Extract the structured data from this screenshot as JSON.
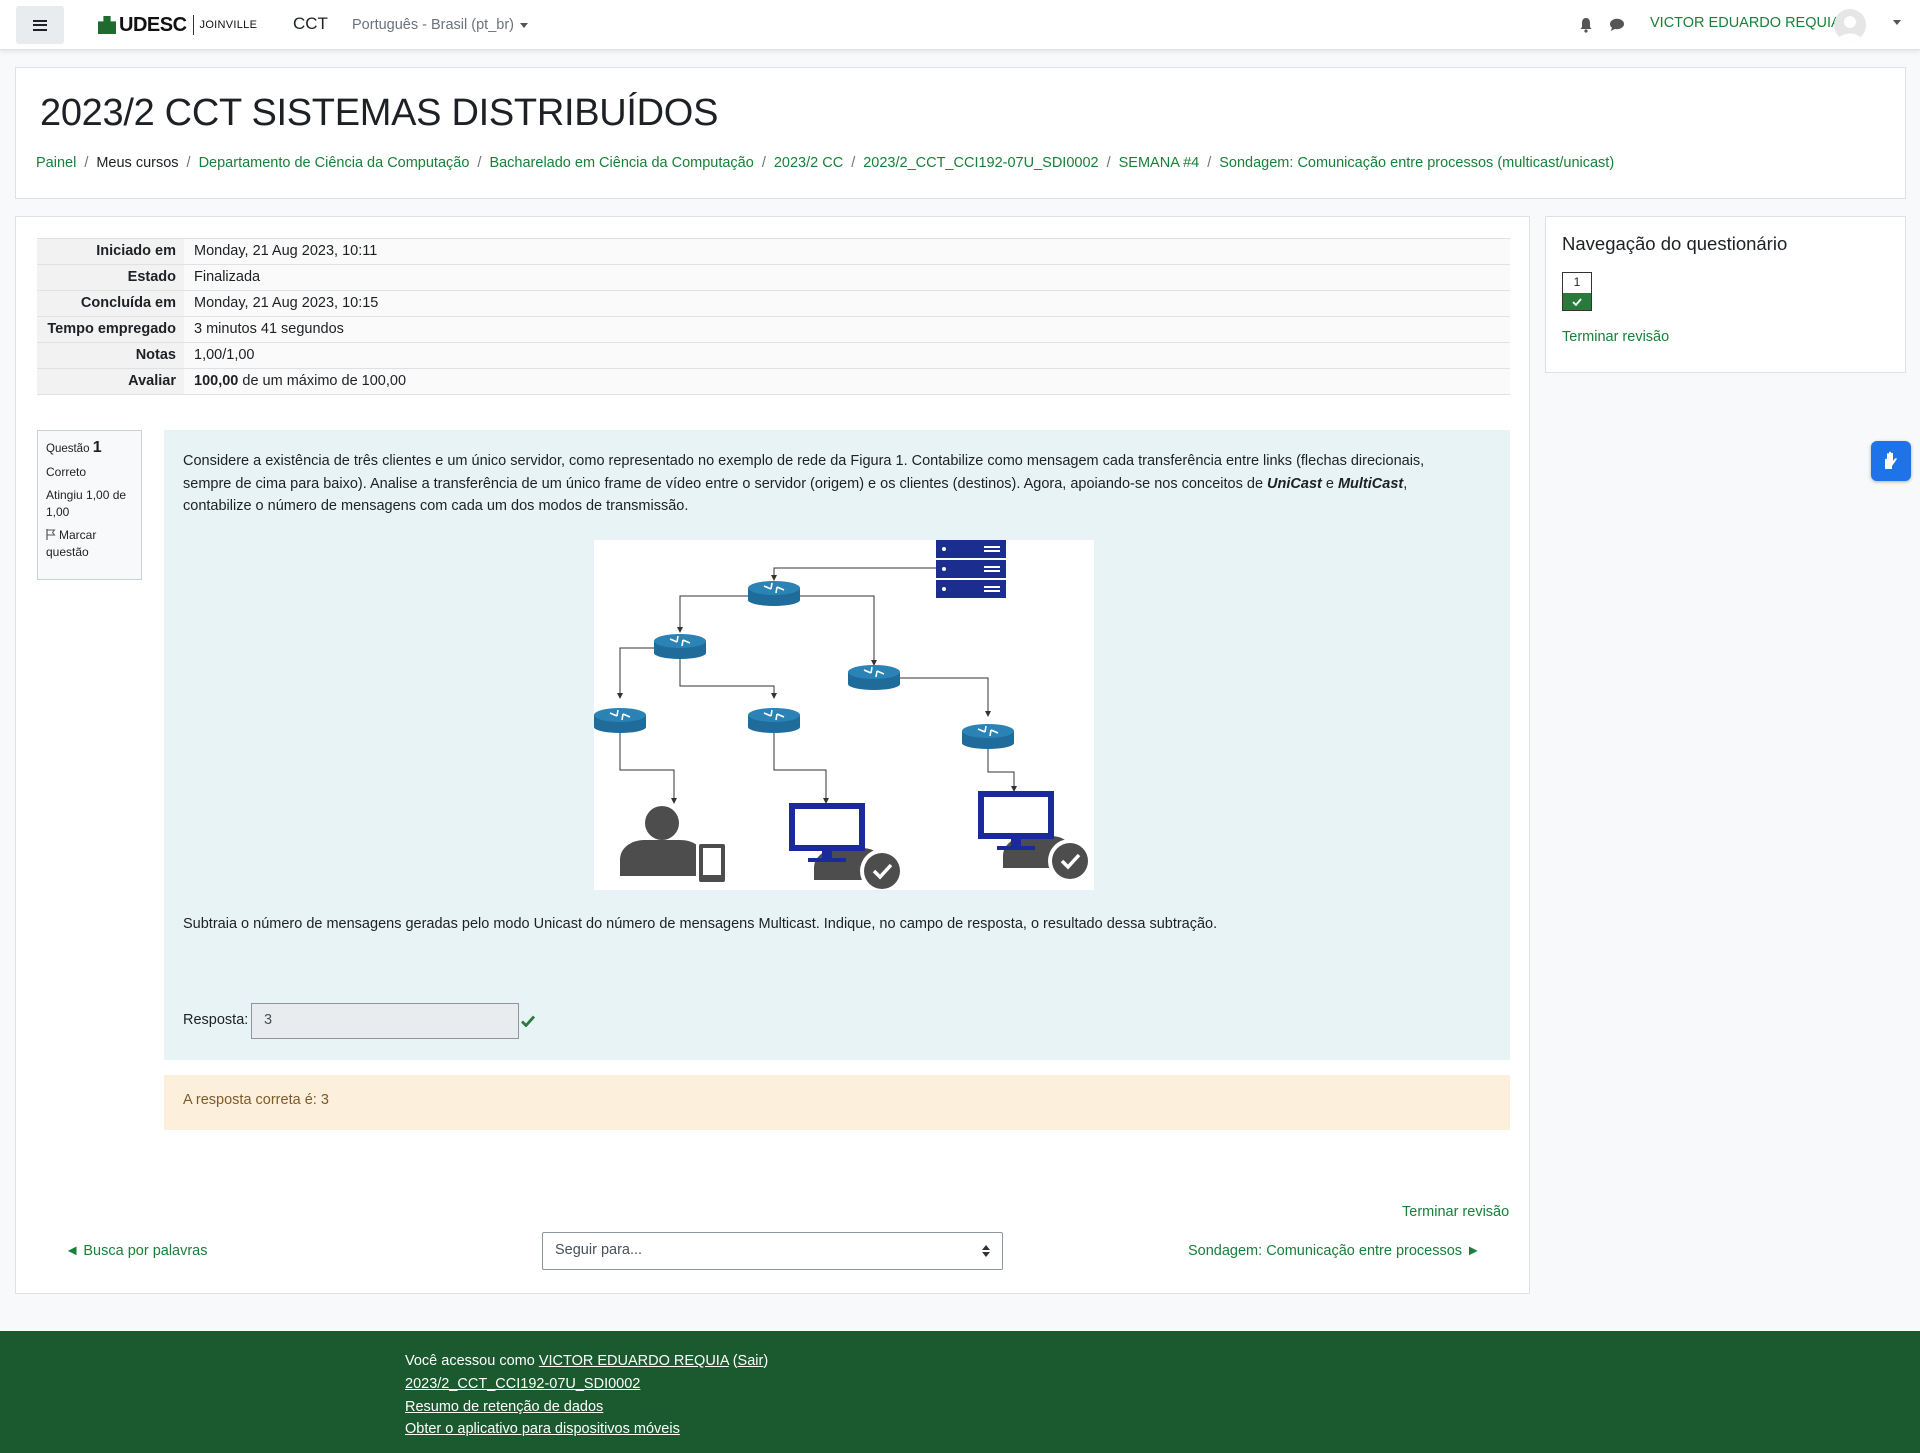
{
  "navbar": {
    "brand_main": "UDESC",
    "brand_sub": "JOINVILLE",
    "site": "CCT",
    "language": "Português - Brasil (pt_br)",
    "user_name": "VICTOR EDUARDO REQUIA"
  },
  "header": {
    "title": "2023/2 CCT SISTEMAS DISTRIBUÍDOS",
    "breadcrumb": [
      "Painel",
      "Meus cursos",
      "Departamento de Ciência da Computação",
      "Bacharelado em Ciência da Computação",
      "2023/2 CC",
      "2023/2_CCT_CCI192-07U_SDI0002",
      "SEMANA #4",
      "Sondagem: Comunicação entre processos (multicast/unicast)"
    ]
  },
  "summary": {
    "rows": [
      {
        "label": "Iniciado em",
        "value": "Monday, 21 Aug 2023, 10:11"
      },
      {
        "label": "Estado",
        "value": "Finalizada"
      },
      {
        "label": "Concluída em",
        "value": "Monday, 21 Aug 2023, 10:15"
      },
      {
        "label": "Tempo empregado",
        "value": "3 minutos 41 segundos"
      },
      {
        "label": "Notas",
        "value": "1,00/1,00"
      },
      {
        "label": "Avaliar",
        "value_bold": "100,00",
        "value": " de um máximo de 100,00"
      }
    ]
  },
  "question": {
    "info": {
      "label": "Questão",
      "number": "1",
      "state": "Correto",
      "grade": "Atingiu 1,00 de 1,00",
      "flag": "Marcar questão"
    },
    "text_part1": "Considere a existência de três clientes e um único servidor, como representado no exemplo de rede da Figura 1. Contabilize como mensagem cada transferência entre links (flechas direcionais, sempre de cima para baixo). Analise a transferência de um único frame de vídeo entre o servidor (origem) e os clientes (destinos). Agora, apoiando-se nos conceitos de ",
    "term_unicast": "UniCast",
    "text_and": " e ",
    "term_multicast": "MultiCast",
    "text_part2": ", contabilize o número de mensagens com cada um dos modos de transmissão.",
    "text_subtract": "Subtraia o número de mensagens geradas pelo modo Unicast do número de mensagens Multicast. Indique, no campo de resposta, o resultado dessa subtração.",
    "answer_label": "Resposta:",
    "answer_value": "3",
    "correct_answer": "A resposta correta é: 3"
  },
  "navigation": {
    "finish_review": "Terminar revisão",
    "prev_link": "◄ Busca por palavras",
    "jump_placeholder": "Seguir para...",
    "next_link": "Sondagem: Comunicação entre processos ►"
  },
  "quiz_nav": {
    "title": "Navegação do questionário",
    "buttons": [
      "1"
    ],
    "finish": "Terminar revisão"
  },
  "footer": {
    "logged_in_prefix": "Você acessou como ",
    "user": "VICTOR EDUARDO REQUIA",
    "logout_open": " (",
    "logout": "Sair",
    "logout_close": ")",
    "course_link": "2023/2_CCT_CCI192-07U_SDI0002",
    "retention": "Resumo de retenção de dados",
    "mobile_app": "Obter o aplicativo para dispositivos móveis"
  },
  "colors": {
    "link_green": "#188038",
    "footer_bg": "#1a5a2e",
    "formulation_bg": "#e7f3f5",
    "outcome_bg": "#fcefdc",
    "router_blue": "#1f6b9a",
    "server_navy": "#1b2e8f",
    "correct_green": "#2a7a3b"
  }
}
